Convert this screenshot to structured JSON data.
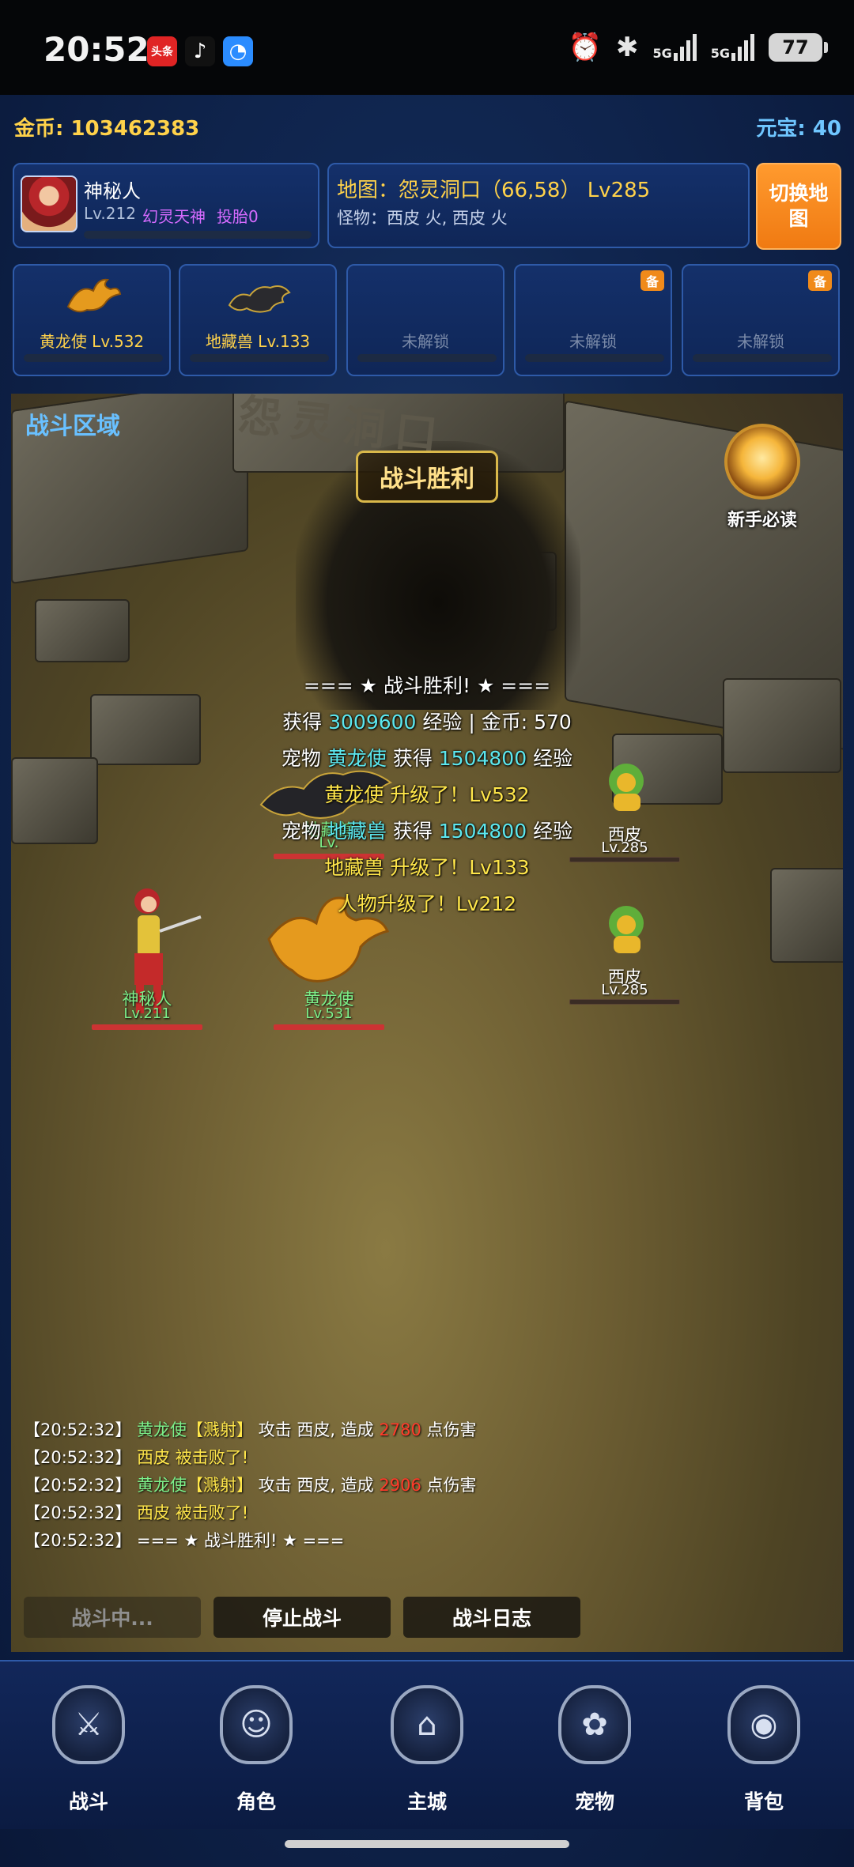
{
  "status_bar": {
    "time": "20:52",
    "apps": [
      "头条",
      "♪",
      "◔"
    ],
    "net1": "5G",
    "net2": "5G",
    "battery": "77"
  },
  "header": {
    "gold_label": "金币: 103462383",
    "yuanbao_label": "元宝: 40"
  },
  "player": {
    "name": "神秘人",
    "level": "Lv.212",
    "title": "幻灵天神",
    "reborn": "投胎0"
  },
  "map": {
    "line": "地图：怨灵洞口（66,58） Lv285",
    "monsters": "怪物：西皮 火, 西皮 火",
    "switch_label": "切换地图"
  },
  "pet_slots": [
    {
      "label": "黄龙使 Lv.532",
      "badge": ""
    },
    {
      "label": "地藏兽 Lv.133",
      "badge": ""
    },
    {
      "label": "未解锁",
      "badge": ""
    },
    {
      "label": "未解锁",
      "badge": "备"
    },
    {
      "label": "未解锁",
      "badge": "备"
    }
  ],
  "battle": {
    "zone_label": "战斗区域",
    "victory_label": "战斗胜利",
    "cave_sign": "怨灵洞口",
    "guide_label": "新手必读",
    "messages": {
      "l1": "=== ★ 战斗胜利! ★ ===",
      "l2_a": "获得 ",
      "l2_b": "3009600",
      "l2_c": " 经验 | 金币: 570",
      "l3_a": "宠物 ",
      "l3_b": "黄龙使",
      "l3_c": " 获得 ",
      "l3_d": "1504800",
      "l3_e": " 经验",
      "l4": "黄龙使 升级了！Lv532",
      "l5_a": "宠物 ",
      "l5_b": "地藏兽",
      "l5_c": " 获得 ",
      "l5_d": "1504800",
      "l5_e": " 经验",
      "l6": "地藏兽 升级了！Lv133",
      "l7": "人物升级了！Lv212"
    },
    "units": {
      "player": {
        "name": "神秘人",
        "lv": "Lv.211"
      },
      "pet1": {
        "name": "黄龙使",
        "lv": "Lv.531"
      },
      "pet2": {
        "name": "地藏兽",
        "lv": "Lv."
      },
      "enemy1": {
        "name": "西皮",
        "lv": "Lv.285"
      },
      "enemy2": {
        "name": "西皮",
        "lv": "Lv.285"
      }
    },
    "log": [
      {
        "time": "【20:52:32】",
        "pet": "黄龙使",
        "skill": "【溅射】",
        "mid": " 攻击 西皮, 造成 ",
        "dmg": "2780",
        "end": " 点伤害"
      },
      {
        "time": "【20:52:32】",
        "enemy": "西皮 被击败了!"
      },
      {
        "time": "【20:52:32】",
        "pet": "黄龙使",
        "skill": "【溅射】",
        "mid": " 攻击 西皮, 造成 ",
        "dmg": "2906",
        "end": " 点伤害"
      },
      {
        "time": "【20:52:32】",
        "enemy": "西皮 被击败了!"
      },
      {
        "time": "【20:52:32】",
        "plain": "=== ★ 战斗胜利! ★ ==="
      }
    ],
    "controls": {
      "fighting": "战斗中...",
      "stop": "停止战斗",
      "log": "战斗日志"
    }
  },
  "nav": [
    {
      "label": "战斗",
      "icon": "crossed-swords-icon",
      "glyph": "⚔"
    },
    {
      "label": "角色",
      "icon": "character-icon",
      "glyph": "☺"
    },
    {
      "label": "主城",
      "icon": "castle-icon",
      "glyph": "⌂"
    },
    {
      "label": "宠物",
      "icon": "paw-icon",
      "glyph": "✿"
    },
    {
      "label": "背包",
      "icon": "bag-icon",
      "glyph": "◉"
    }
  ],
  "colors": {
    "gold": "#ffd24a",
    "yuanbao": "#6fc6ff",
    "switch_button": "#f07a12",
    "damage": "#ff3b2a",
    "pet_name": "#7cf08a"
  }
}
